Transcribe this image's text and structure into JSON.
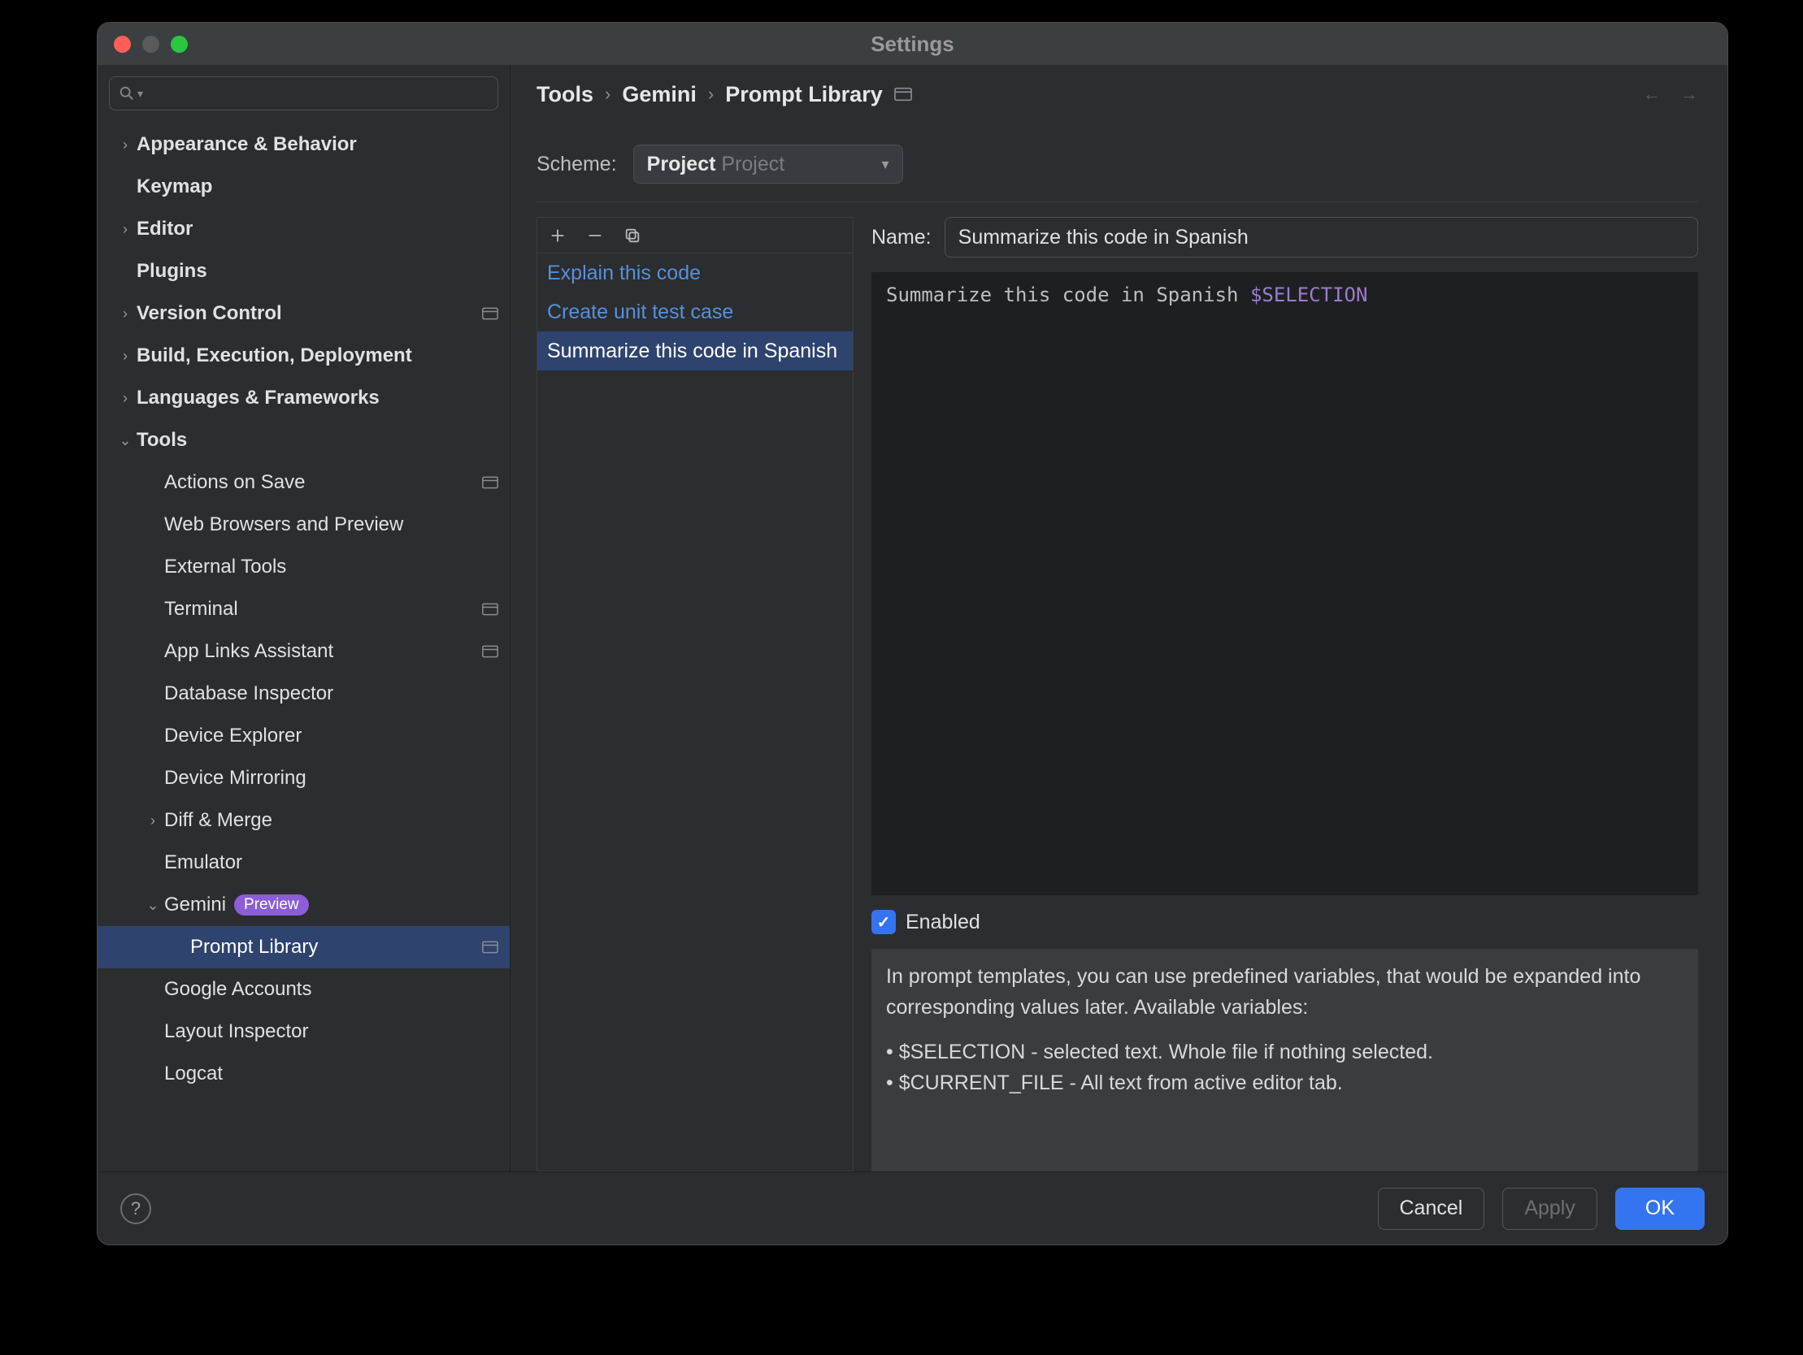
{
  "window": {
    "title": "Settings"
  },
  "sidebar": {
    "search_placeholder": "",
    "items": [
      {
        "label": "Appearance & Behavior",
        "chevron": "right",
        "bold": true,
        "indent": 0
      },
      {
        "label": "Keymap",
        "bold": true,
        "indent": 0
      },
      {
        "label": "Editor",
        "chevron": "right",
        "bold": true,
        "indent": 0
      },
      {
        "label": "Plugins",
        "bold": true,
        "indent": 0
      },
      {
        "label": "Version Control",
        "chevron": "right",
        "bold": true,
        "indent": 0,
        "tag": true
      },
      {
        "label": "Build, Execution, Deployment",
        "chevron": "right",
        "bold": true,
        "indent": 0
      },
      {
        "label": "Languages & Frameworks",
        "chevron": "right",
        "bold": true,
        "indent": 0
      },
      {
        "label": "Tools",
        "chevron": "down",
        "bold": true,
        "indent": 0
      },
      {
        "label": "Actions on Save",
        "indent": 1,
        "tag": true
      },
      {
        "label": "Web Browsers and Preview",
        "indent": 1
      },
      {
        "label": "External Tools",
        "indent": 1
      },
      {
        "label": "Terminal",
        "indent": 1,
        "tag": true
      },
      {
        "label": "App Links Assistant",
        "indent": 1,
        "tag": true
      },
      {
        "label": "Database Inspector",
        "indent": 1
      },
      {
        "label": "Device Explorer",
        "indent": 1
      },
      {
        "label": "Device Mirroring",
        "indent": 1
      },
      {
        "label": "Diff & Merge",
        "chevron": "right",
        "indent": 1
      },
      {
        "label": "Emulator",
        "indent": 1
      },
      {
        "label": "Gemini",
        "chevron": "down",
        "indent": 1,
        "pill": "Preview"
      },
      {
        "label": "Prompt Library",
        "indent": 2,
        "active": true,
        "tag": true
      },
      {
        "label": "Google Accounts",
        "indent": 1
      },
      {
        "label": "Layout Inspector",
        "indent": 1
      },
      {
        "label": "Logcat",
        "indent": 1
      }
    ]
  },
  "breadcrumbs": [
    "Tools",
    "Gemini",
    "Prompt Library"
  ],
  "scheme": {
    "label": "Scheme:",
    "selected": "Project",
    "dim": "Project"
  },
  "promptList": {
    "items": [
      {
        "label": "Explain this code"
      },
      {
        "label": "Create unit test case"
      },
      {
        "label": "Summarize this code in Spanish",
        "selected": true
      }
    ]
  },
  "editor": {
    "name_label": "Name:",
    "name_value": "Summarize this code in Spanish",
    "body_plain": "Summarize this code in Spanish ",
    "body_token": "$SELECTION",
    "enabled_label": "Enabled",
    "enabled": true,
    "help_intro": "In prompt templates, you can use predefined variables, that would be expanded into corresponding values later. Available variables:",
    "help_vars": [
      "$SELECTION - selected text. Whole file if nothing selected.",
      "$CURRENT_FILE - All text from active editor tab."
    ]
  },
  "footer": {
    "cancel": "Cancel",
    "apply": "Apply",
    "ok": "OK"
  }
}
